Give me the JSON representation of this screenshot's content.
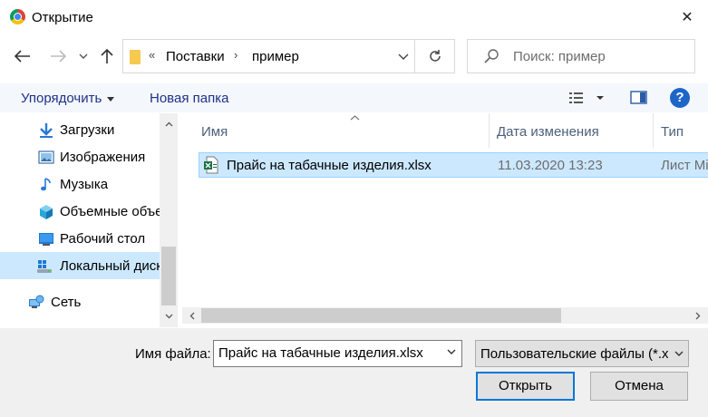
{
  "window": {
    "title": "Открытие",
    "close_glyph": "✕"
  },
  "addressbar": {
    "breadcrumb_prefix": "«",
    "crumbs": [
      "Поставки",
      "пример"
    ],
    "separator": "›"
  },
  "search": {
    "placeholder": "Поиск: пример"
  },
  "toolbar": {
    "organize_label": "Упорядочить",
    "new_folder_label": "Новая папка",
    "help_label": "?"
  },
  "nav": {
    "items": [
      {
        "label": "Загрузки",
        "icon": "download-icon"
      },
      {
        "label": "Изображения",
        "icon": "pictures-icon"
      },
      {
        "label": "Музыка",
        "icon": "music-icon"
      },
      {
        "label": "Объемные объекты",
        "icon": "3d-objects-icon"
      },
      {
        "label": "Рабочий стол",
        "icon": "desktop-icon"
      },
      {
        "label": "Локальный диск",
        "icon": "drive-icon",
        "selected": true
      },
      {
        "label": "Сеть",
        "icon": "network-icon"
      }
    ]
  },
  "file_list": {
    "columns": [
      "Имя",
      "Дата изменения",
      "Тип"
    ],
    "files": [
      {
        "name": "Прайс на табачные изделия.xlsx",
        "modified": "11.03.2020 13:23",
        "type": "Лист Microsoft Excel",
        "icon": "excel-file-icon",
        "selected": true
      }
    ]
  },
  "footer": {
    "filename_label": "Имя файла:",
    "filename_value": "Прайс на табачные изделия.xlsx",
    "filetype_value": "Пользовательские файлы (*.xlsx)",
    "open_label": "Открыть",
    "cancel_label": "Отмена"
  },
  "colors": {
    "selection_bg": "#cce8ff",
    "selection_border": "#99d1ff",
    "toolbar_bg": "#f4f7fc",
    "toolbar_text": "#1e3287",
    "accent": "#0078d7",
    "footer_bg": "#f0f0f0"
  }
}
